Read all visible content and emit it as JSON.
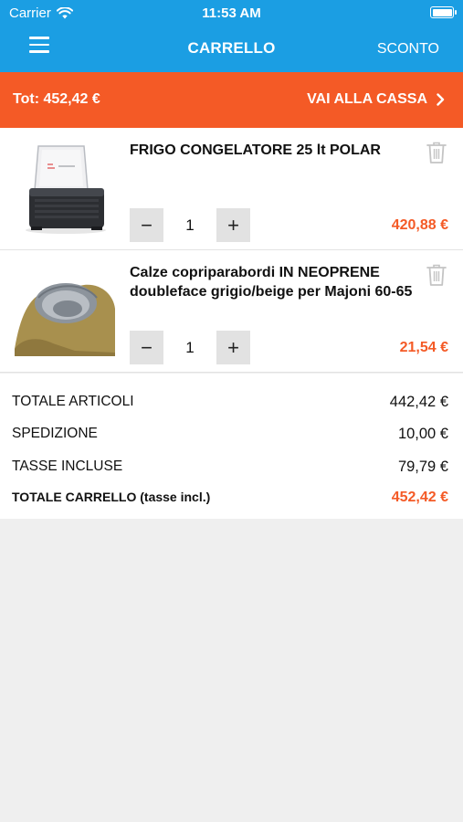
{
  "status_bar": {
    "carrier": "Carrier",
    "time": "11:53 AM",
    "battery_level": 1.0
  },
  "nav": {
    "title": "CARRELLO",
    "action_label": "SCONTO",
    "menu_icon": "hamburger-icon"
  },
  "checkout": {
    "total_label": "Tot: 452,42 €",
    "button_label": "VAI ALLA CASSA",
    "button_icon": "chevron-right-icon"
  },
  "items": [
    {
      "name": "FRIGO CONGELATORE 25 lt POLAR",
      "quantity": "1",
      "price": "420,88 €",
      "image_icon": "fridge-freezer-image"
    },
    {
      "name": "Calze copriparabordi IN NEOPRENE doubleface grigio/beige per Majoni 60-65",
      "quantity": "1",
      "price": "21,54 €",
      "image_icon": "fender-cover-image"
    }
  ],
  "qty_controls": {
    "minus": "−",
    "plus": "+"
  },
  "summary": {
    "rows": [
      {
        "label": "TOTALE ARTICOLI",
        "value": "442,42 €"
      },
      {
        "label": "SPEDIZIONE",
        "value": "10,00 €"
      },
      {
        "label": "TASSE INCLUSE",
        "value": "79,79 €"
      }
    ],
    "total": {
      "label": "TOTALE CARRELLO (tasse incl.)",
      "value": "452,42 €"
    }
  },
  "colors": {
    "header": "#1b9ee3",
    "accent": "#f45a26",
    "background": "#efefef"
  }
}
